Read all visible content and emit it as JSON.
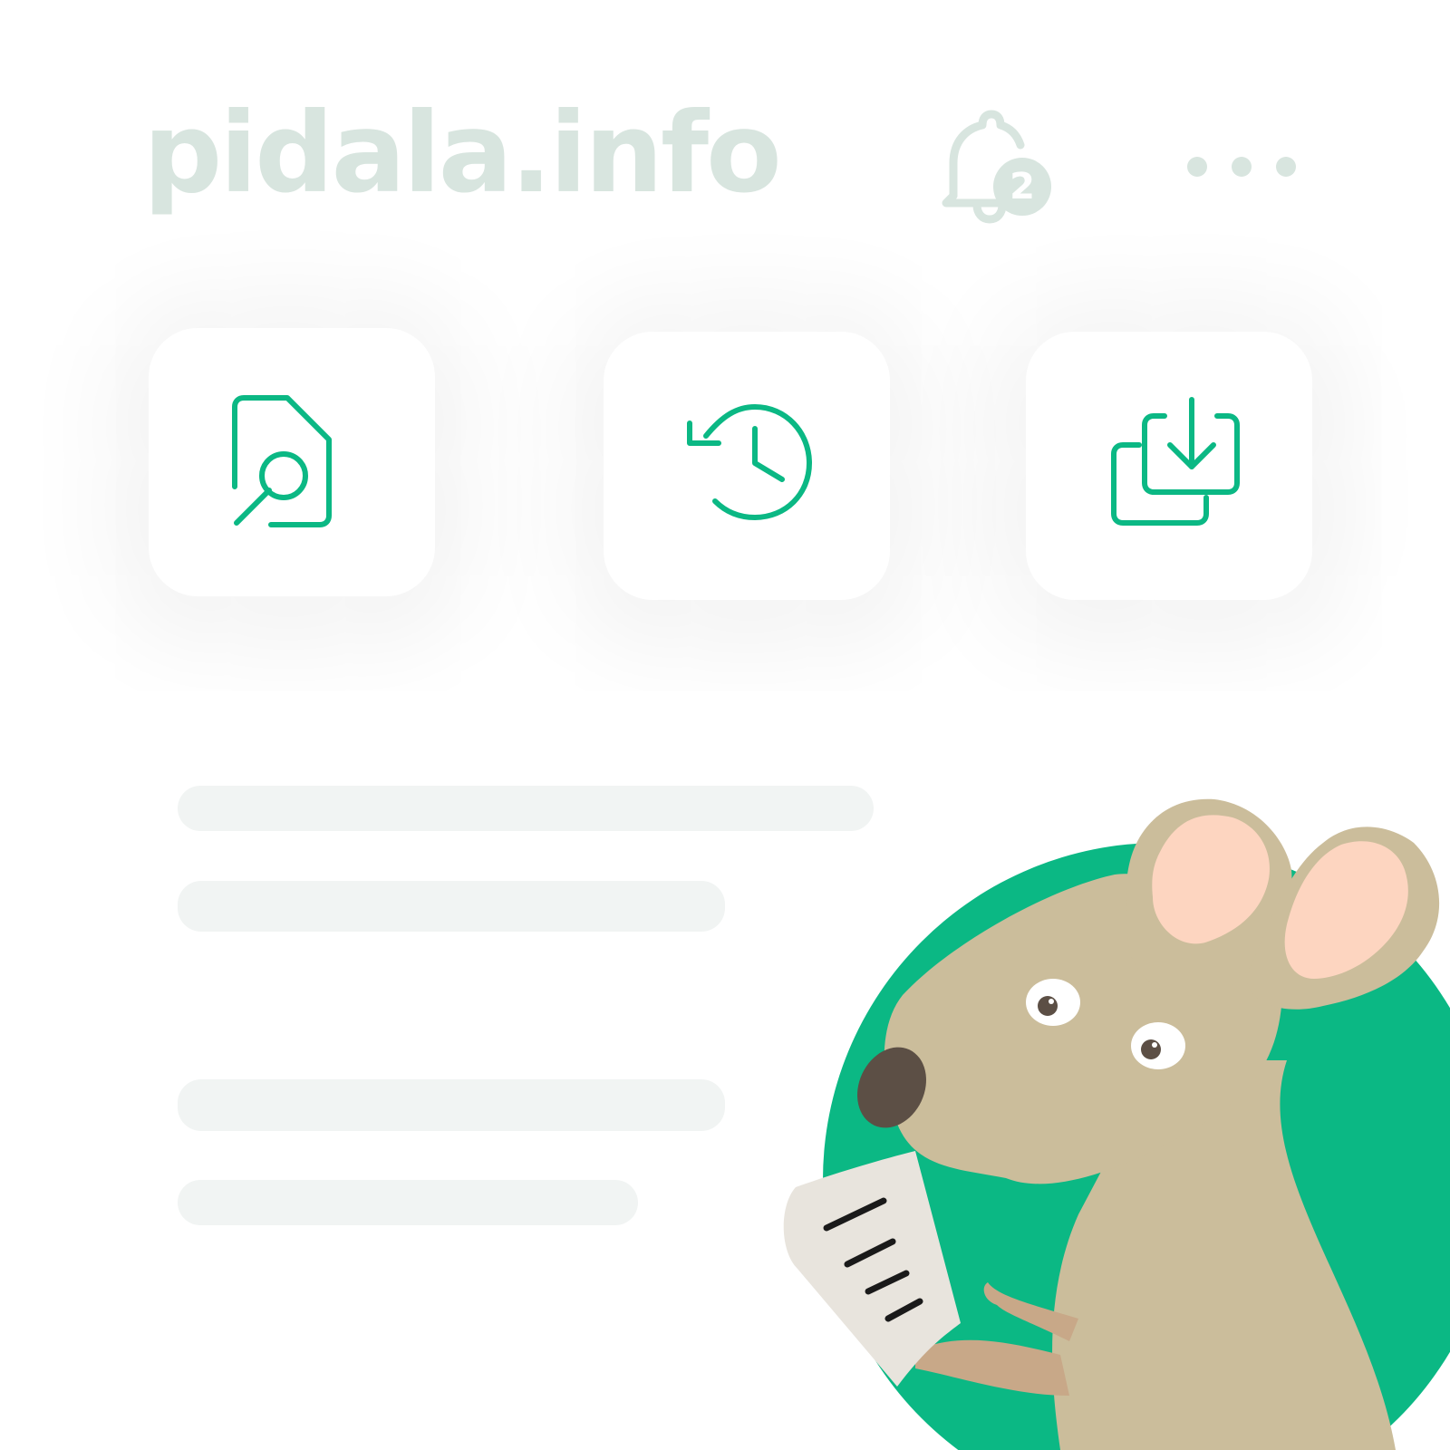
{
  "header": {
    "logo_text": "pidala.info",
    "notification_count": "2",
    "icons": {
      "bell": "bell-icon",
      "more": "more-horizontal-icon"
    }
  },
  "actions": [
    {
      "icon": "document-search-icon"
    },
    {
      "icon": "history-clock-icon"
    },
    {
      "icon": "download-copies-icon"
    }
  ],
  "mascot": {
    "icon": "mouse-mascot-with-document"
  },
  "colors": {
    "accent": "#0bb884",
    "muted": "#d8e5df",
    "skeleton": "#f1f4f3",
    "mascot_fur": "#cbbd9b",
    "mascot_ear": "#fdd5c0",
    "mascot_nose": "#5c4f45"
  }
}
